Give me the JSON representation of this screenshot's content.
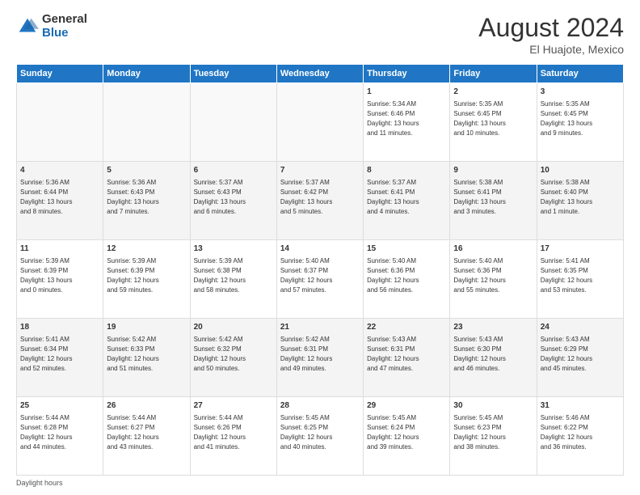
{
  "logo": {
    "general": "General",
    "blue": "Blue"
  },
  "title": {
    "month_year": "August 2024",
    "location": "El Huajote, Mexico"
  },
  "headers": [
    "Sunday",
    "Monday",
    "Tuesday",
    "Wednesday",
    "Thursday",
    "Friday",
    "Saturday"
  ],
  "weeks": [
    [
      {
        "day": "",
        "info": ""
      },
      {
        "day": "",
        "info": ""
      },
      {
        "day": "",
        "info": ""
      },
      {
        "day": "",
        "info": ""
      },
      {
        "day": "1",
        "info": "Sunrise: 5:34 AM\nSunset: 6:46 PM\nDaylight: 13 hours\nand 11 minutes."
      },
      {
        "day": "2",
        "info": "Sunrise: 5:35 AM\nSunset: 6:45 PM\nDaylight: 13 hours\nand 10 minutes."
      },
      {
        "day": "3",
        "info": "Sunrise: 5:35 AM\nSunset: 6:45 PM\nDaylight: 13 hours\nand 9 minutes."
      }
    ],
    [
      {
        "day": "4",
        "info": "Sunrise: 5:36 AM\nSunset: 6:44 PM\nDaylight: 13 hours\nand 8 minutes."
      },
      {
        "day": "5",
        "info": "Sunrise: 5:36 AM\nSunset: 6:43 PM\nDaylight: 13 hours\nand 7 minutes."
      },
      {
        "day": "6",
        "info": "Sunrise: 5:37 AM\nSunset: 6:43 PM\nDaylight: 13 hours\nand 6 minutes."
      },
      {
        "day": "7",
        "info": "Sunrise: 5:37 AM\nSunset: 6:42 PM\nDaylight: 13 hours\nand 5 minutes."
      },
      {
        "day": "8",
        "info": "Sunrise: 5:37 AM\nSunset: 6:41 PM\nDaylight: 13 hours\nand 4 minutes."
      },
      {
        "day": "9",
        "info": "Sunrise: 5:38 AM\nSunset: 6:41 PM\nDaylight: 13 hours\nand 3 minutes."
      },
      {
        "day": "10",
        "info": "Sunrise: 5:38 AM\nSunset: 6:40 PM\nDaylight: 13 hours\nand 1 minute."
      }
    ],
    [
      {
        "day": "11",
        "info": "Sunrise: 5:39 AM\nSunset: 6:39 PM\nDaylight: 13 hours\nand 0 minutes."
      },
      {
        "day": "12",
        "info": "Sunrise: 5:39 AM\nSunset: 6:39 PM\nDaylight: 12 hours\nand 59 minutes."
      },
      {
        "day": "13",
        "info": "Sunrise: 5:39 AM\nSunset: 6:38 PM\nDaylight: 12 hours\nand 58 minutes."
      },
      {
        "day": "14",
        "info": "Sunrise: 5:40 AM\nSunset: 6:37 PM\nDaylight: 12 hours\nand 57 minutes."
      },
      {
        "day": "15",
        "info": "Sunrise: 5:40 AM\nSunset: 6:36 PM\nDaylight: 12 hours\nand 56 minutes."
      },
      {
        "day": "16",
        "info": "Sunrise: 5:40 AM\nSunset: 6:36 PM\nDaylight: 12 hours\nand 55 minutes."
      },
      {
        "day": "17",
        "info": "Sunrise: 5:41 AM\nSunset: 6:35 PM\nDaylight: 12 hours\nand 53 minutes."
      }
    ],
    [
      {
        "day": "18",
        "info": "Sunrise: 5:41 AM\nSunset: 6:34 PM\nDaylight: 12 hours\nand 52 minutes."
      },
      {
        "day": "19",
        "info": "Sunrise: 5:42 AM\nSunset: 6:33 PM\nDaylight: 12 hours\nand 51 minutes."
      },
      {
        "day": "20",
        "info": "Sunrise: 5:42 AM\nSunset: 6:32 PM\nDaylight: 12 hours\nand 50 minutes."
      },
      {
        "day": "21",
        "info": "Sunrise: 5:42 AM\nSunset: 6:31 PM\nDaylight: 12 hours\nand 49 minutes."
      },
      {
        "day": "22",
        "info": "Sunrise: 5:43 AM\nSunset: 6:31 PM\nDaylight: 12 hours\nand 47 minutes."
      },
      {
        "day": "23",
        "info": "Sunrise: 5:43 AM\nSunset: 6:30 PM\nDaylight: 12 hours\nand 46 minutes."
      },
      {
        "day": "24",
        "info": "Sunrise: 5:43 AM\nSunset: 6:29 PM\nDaylight: 12 hours\nand 45 minutes."
      }
    ],
    [
      {
        "day": "25",
        "info": "Sunrise: 5:44 AM\nSunset: 6:28 PM\nDaylight: 12 hours\nand 44 minutes."
      },
      {
        "day": "26",
        "info": "Sunrise: 5:44 AM\nSunset: 6:27 PM\nDaylight: 12 hours\nand 43 minutes."
      },
      {
        "day": "27",
        "info": "Sunrise: 5:44 AM\nSunset: 6:26 PM\nDaylight: 12 hours\nand 41 minutes."
      },
      {
        "day": "28",
        "info": "Sunrise: 5:45 AM\nSunset: 6:25 PM\nDaylight: 12 hours\nand 40 minutes."
      },
      {
        "day": "29",
        "info": "Sunrise: 5:45 AM\nSunset: 6:24 PM\nDaylight: 12 hours\nand 39 minutes."
      },
      {
        "day": "30",
        "info": "Sunrise: 5:45 AM\nSunset: 6:23 PM\nDaylight: 12 hours\nand 38 minutes."
      },
      {
        "day": "31",
        "info": "Sunrise: 5:46 AM\nSunset: 6:22 PM\nDaylight: 12 hours\nand 36 minutes."
      }
    ]
  ],
  "footer": {
    "note": "Daylight hours"
  }
}
